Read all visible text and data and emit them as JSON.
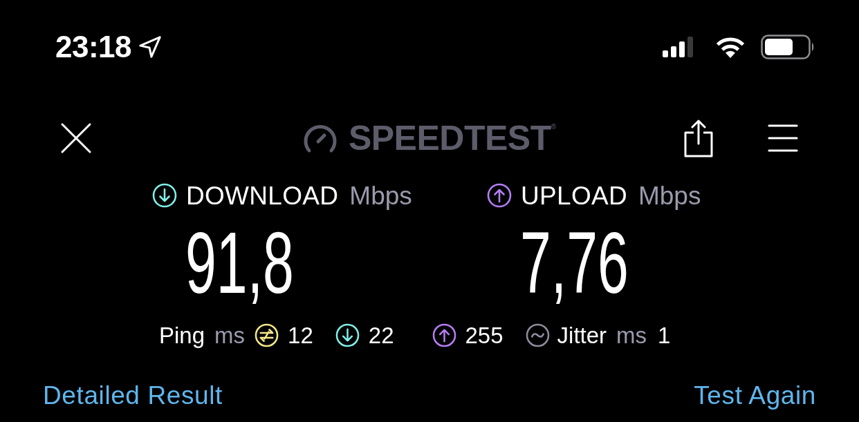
{
  "status_bar": {
    "time": "23:18"
  },
  "header": {
    "logo_text": "SPEEDTEST",
    "trademark": "®"
  },
  "results": [
    {
      "kind": "download",
      "label": "DOWNLOAD",
      "unit": "Mbps",
      "value": "91,8",
      "color": "#80efe8"
    },
    {
      "kind": "upload",
      "label": "UPLOAD",
      "unit": "Mbps",
      "value": "7,76",
      "color": "#b57df3"
    }
  ],
  "ping": {
    "label": "Ping",
    "unit": "ms",
    "readings": [
      {
        "kind": "idle",
        "color": "#f4e78a",
        "value": "12"
      },
      {
        "kind": "download",
        "color": "#80efe8",
        "value": "22"
      },
      {
        "kind": "upload",
        "color": "#b57df3",
        "value": "255"
      }
    ]
  },
  "jitter": {
    "label": "Jitter",
    "unit": "ms",
    "value": "1"
  },
  "links": [
    {
      "label": "Detailed Result"
    },
    {
      "label": "Test Again"
    }
  ]
}
